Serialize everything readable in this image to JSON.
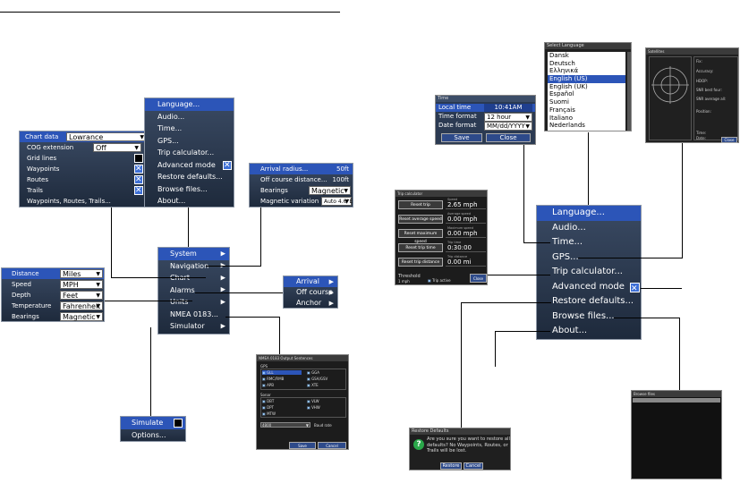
{
  "left_menus": {
    "chart_data_menu": {
      "rows": [
        {
          "label": "Chart data",
          "value": "Lowrance"
        },
        {
          "label": "COG extension",
          "value": "Off"
        },
        {
          "label": "Grid lines"
        },
        {
          "label": "Waypoints"
        },
        {
          "label": "Routes"
        },
        {
          "label": "Trails"
        },
        {
          "label": "Waypoints, Routes, Trails..."
        }
      ]
    },
    "system_menu": {
      "items": [
        "Language...",
        "Audio...",
        "Time...",
        "GPS...",
        "Trip calculator...",
        "Advanced mode",
        "Restore defaults...",
        "Browse files...",
        "About..."
      ]
    },
    "navigation_menu": {
      "rows": [
        {
          "label": "Arrival radius...",
          "value": "50ft"
        },
        {
          "label": "Off course distance...",
          "value": "100ft"
        },
        {
          "label": "Bearings",
          "value": "Magnetic"
        },
        {
          "label": "Magnetic variation",
          "value": "Auto 4.6°E"
        }
      ]
    },
    "units_menu": {
      "rows": [
        {
          "label": "Distance",
          "value": "Miles"
        },
        {
          "label": "Speed",
          "value": "MPH"
        },
        {
          "label": "Depth",
          "value": "Feet"
        },
        {
          "label": "Temperature",
          "value": "Fahrenheit"
        },
        {
          "label": "Bearings",
          "value": "Magnetic"
        }
      ]
    },
    "main_menu": {
      "items": [
        "System",
        "Navigation",
        "Chart",
        "Alarms",
        "Units",
        "NMEA 0183...",
        "Simulator"
      ]
    },
    "alarms_menu": {
      "items": [
        "Arrival",
        "Off course",
        "Anchor"
      ]
    },
    "simulator_menu": {
      "items": [
        "Simulate",
        "Options..."
      ]
    },
    "nmea_dialog": {
      "title": "NMEA 0183 Output Sentences",
      "gps_label": "GPS",
      "gps_items": [
        "GLL",
        "GGA",
        "RMC/RMB",
        "GSA/GSV",
        "APB",
        "XTE"
      ],
      "sonar_label": "Sonar",
      "sonar_items": [
        "DBT",
        "VLW",
        "DPT",
        "VHW",
        "MTW"
      ],
      "baud_value": "4800",
      "baud_label": "Baud rate",
      "save": "Save",
      "cancel": "Cancel"
    }
  },
  "right_menus": {
    "time_dialog": {
      "title": "Time",
      "rows": [
        {
          "label": "Local time",
          "value": "10:41AM"
        },
        {
          "label": "Time format",
          "value": "12 hour"
        },
        {
          "label": "Date format",
          "value": "MM/dd/YYYY"
        }
      ],
      "save": "Save",
      "close": "Close"
    },
    "language_dialog": {
      "title": "Select Language",
      "items": [
        "Dansk",
        "Deutsch",
        "Ελληνικά",
        "English (US)",
        "English (UK)",
        "Español",
        "Suomi",
        "Français",
        "Italiano",
        "Nederlands"
      ],
      "selected": 3
    },
    "gps_dialog": {
      "title": "Satellites",
      "lines": [
        "Fix:",
        "Accuracy:",
        "HDOP:",
        "SNR best four:",
        "SNR average all:",
        "Position:",
        "Time:",
        "Date:"
      ],
      "close": "Close"
    },
    "trip_dialog": {
      "title": "Trip calculator",
      "buttons": [
        "Reset trip",
        "Reset average speed",
        "Reset maximum speed",
        "Reset trip time",
        "Reset trip distance"
      ],
      "field_labels": [
        "Speed",
        "Average speed",
        "Maximum speed",
        "Trip time",
        "Trip distance"
      ],
      "values": [
        "2.65 mph",
        "0.00 mph",
        "0.00 mph",
        "0:30:00",
        "0.00 mi"
      ],
      "threshold_label": "Threshold",
      "threshold_value": "1 mph",
      "trip_active": "Trip active",
      "close": "Close"
    },
    "system_menu_large": {
      "items": [
        "Language...",
        "Audio...",
        "Time...",
        "GPS...",
        "Trip calculator...",
        "Advanced mode",
        "Restore defaults...",
        "Browse files...",
        "About..."
      ]
    },
    "restore_dialog": {
      "title": "Restore Defaults",
      "message": "Are you sure you want to restore all defaults? No Waypoints, Routes, or Trails will be lost.",
      "restore": "Restore",
      "cancel": "Cancel"
    },
    "browse_dialog": {
      "title": "Browse files"
    }
  }
}
